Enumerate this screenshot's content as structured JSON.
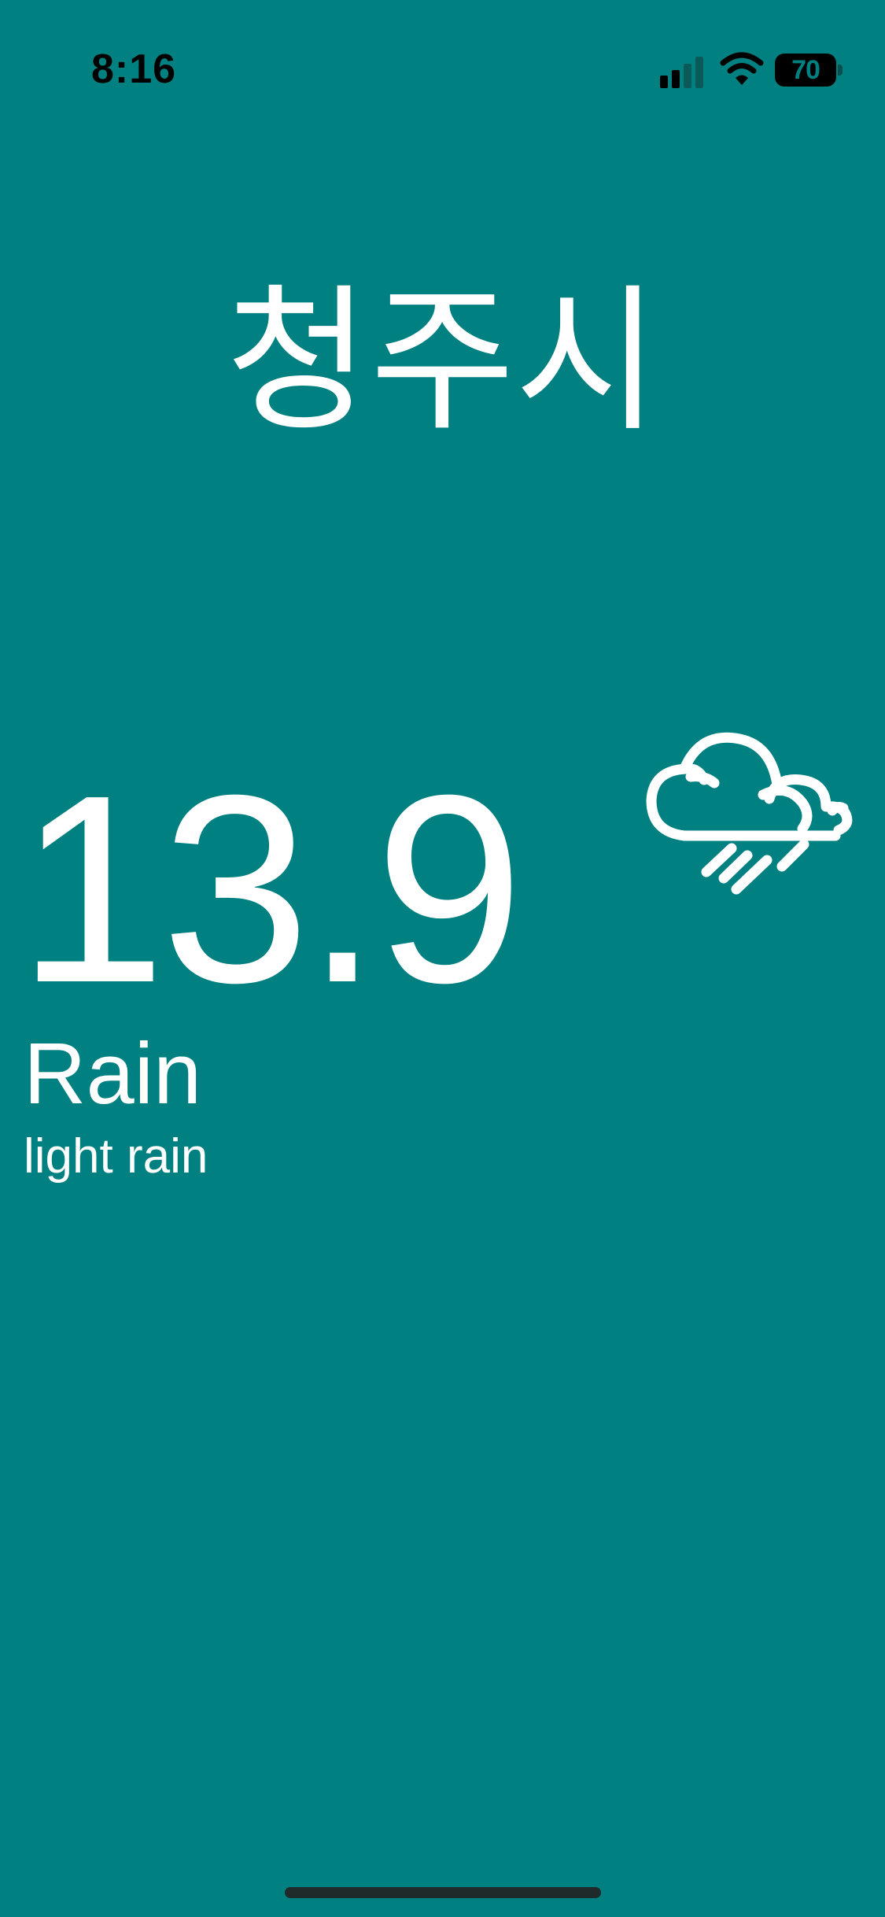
{
  "status_bar": {
    "time": "8:16",
    "battery_level": "70",
    "signal_icon": "cellular-signal-icon",
    "wifi_icon": "wifi-icon",
    "battery_icon": "battery-icon"
  },
  "weather": {
    "city": "청주시",
    "temperature": "13.9",
    "main": "Rain",
    "description": "light rain",
    "icon": "cloud-rain-icon"
  },
  "colors": {
    "background": "#008080",
    "text": "#ffffff",
    "status_text": "#000000"
  }
}
